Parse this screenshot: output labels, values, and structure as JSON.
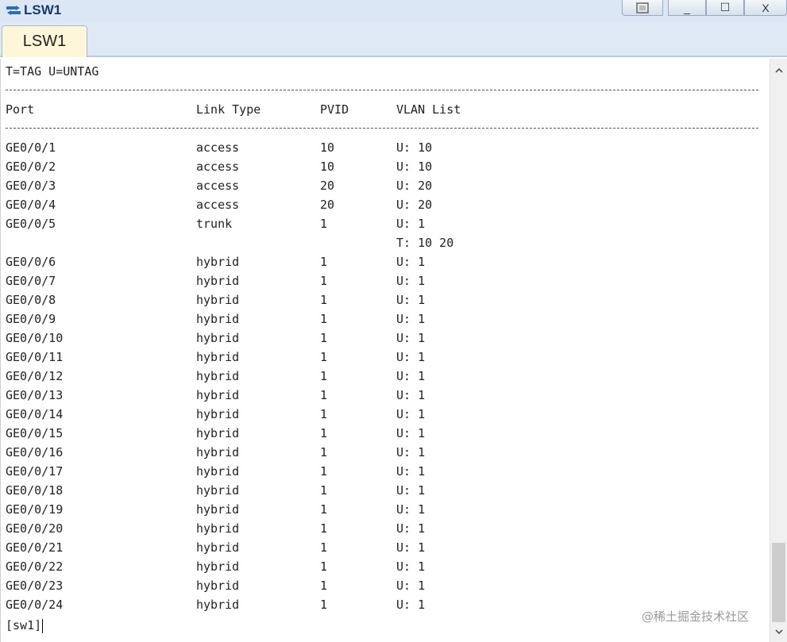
{
  "window": {
    "title": "LSW1",
    "controls": {
      "restore": "",
      "minimize": "_",
      "maximize": "☐",
      "close": "X"
    }
  },
  "tabs": [
    {
      "label": "LSW1",
      "active": true
    }
  ],
  "terminal": {
    "legend": "T=TAG U=UNTAG",
    "headers": {
      "port": "Port",
      "link_type": "Link Type",
      "pvid": "PVID",
      "vlan_list": "VLAN List"
    },
    "rows": [
      {
        "port": "GE0/0/1",
        "link_type": "access",
        "pvid": "10",
        "vlan_list": "U: 10"
      },
      {
        "port": "GE0/0/2",
        "link_type": "access",
        "pvid": "10",
        "vlan_list": "U: 10"
      },
      {
        "port": "GE0/0/3",
        "link_type": "access",
        "pvid": "20",
        "vlan_list": "U: 20"
      },
      {
        "port": "GE0/0/4",
        "link_type": "access",
        "pvid": "20",
        "vlan_list": "U: 20"
      },
      {
        "port": "GE0/0/5",
        "link_type": "trunk",
        "pvid": "1",
        "vlan_list": "U: 1"
      },
      {
        "port": "",
        "link_type": "",
        "pvid": "",
        "vlan_list": "T: 10 20"
      },
      {
        "port": "GE0/0/6",
        "link_type": "hybrid",
        "pvid": "1",
        "vlan_list": "U: 1"
      },
      {
        "port": "GE0/0/7",
        "link_type": "hybrid",
        "pvid": "1",
        "vlan_list": "U: 1"
      },
      {
        "port": "GE0/0/8",
        "link_type": "hybrid",
        "pvid": "1",
        "vlan_list": "U: 1"
      },
      {
        "port": "GE0/0/9",
        "link_type": "hybrid",
        "pvid": "1",
        "vlan_list": "U: 1"
      },
      {
        "port": "GE0/0/10",
        "link_type": "hybrid",
        "pvid": "1",
        "vlan_list": "U: 1"
      },
      {
        "port": "GE0/0/11",
        "link_type": "hybrid",
        "pvid": "1",
        "vlan_list": "U: 1"
      },
      {
        "port": "GE0/0/12",
        "link_type": "hybrid",
        "pvid": "1",
        "vlan_list": "U: 1"
      },
      {
        "port": "GE0/0/13",
        "link_type": "hybrid",
        "pvid": "1",
        "vlan_list": "U: 1"
      },
      {
        "port": "GE0/0/14",
        "link_type": "hybrid",
        "pvid": "1",
        "vlan_list": "U: 1"
      },
      {
        "port": "GE0/0/15",
        "link_type": "hybrid",
        "pvid": "1",
        "vlan_list": "U: 1"
      },
      {
        "port": "GE0/0/16",
        "link_type": "hybrid",
        "pvid": "1",
        "vlan_list": "U: 1"
      },
      {
        "port": "GE0/0/17",
        "link_type": "hybrid",
        "pvid": "1",
        "vlan_list": "U: 1"
      },
      {
        "port": "GE0/0/18",
        "link_type": "hybrid",
        "pvid": "1",
        "vlan_list": "U: 1"
      },
      {
        "port": "GE0/0/19",
        "link_type": "hybrid",
        "pvid": "1",
        "vlan_list": "U: 1"
      },
      {
        "port": "GE0/0/20",
        "link_type": "hybrid",
        "pvid": "1",
        "vlan_list": "U: 1"
      },
      {
        "port": "GE0/0/21",
        "link_type": "hybrid",
        "pvid": "1",
        "vlan_list": "U: 1"
      },
      {
        "port": "GE0/0/22",
        "link_type": "hybrid",
        "pvid": "1",
        "vlan_list": "U: 1"
      },
      {
        "port": "GE0/0/23",
        "link_type": "hybrid",
        "pvid": "1",
        "vlan_list": "U: 1"
      },
      {
        "port": "GE0/0/24",
        "link_type": "hybrid",
        "pvid": "1",
        "vlan_list": "U: 1"
      }
    ],
    "prompt": "[sw1]"
  },
  "scrollbar": {
    "up_icon": "chevron-up-icon",
    "down_icon": "chevron-down-icon"
  },
  "watermark": "@稀土掘金技术社区",
  "colors": {
    "titlebar": "#dbe7f5",
    "tab_active": "#fdf6d8",
    "text": "#222222"
  }
}
